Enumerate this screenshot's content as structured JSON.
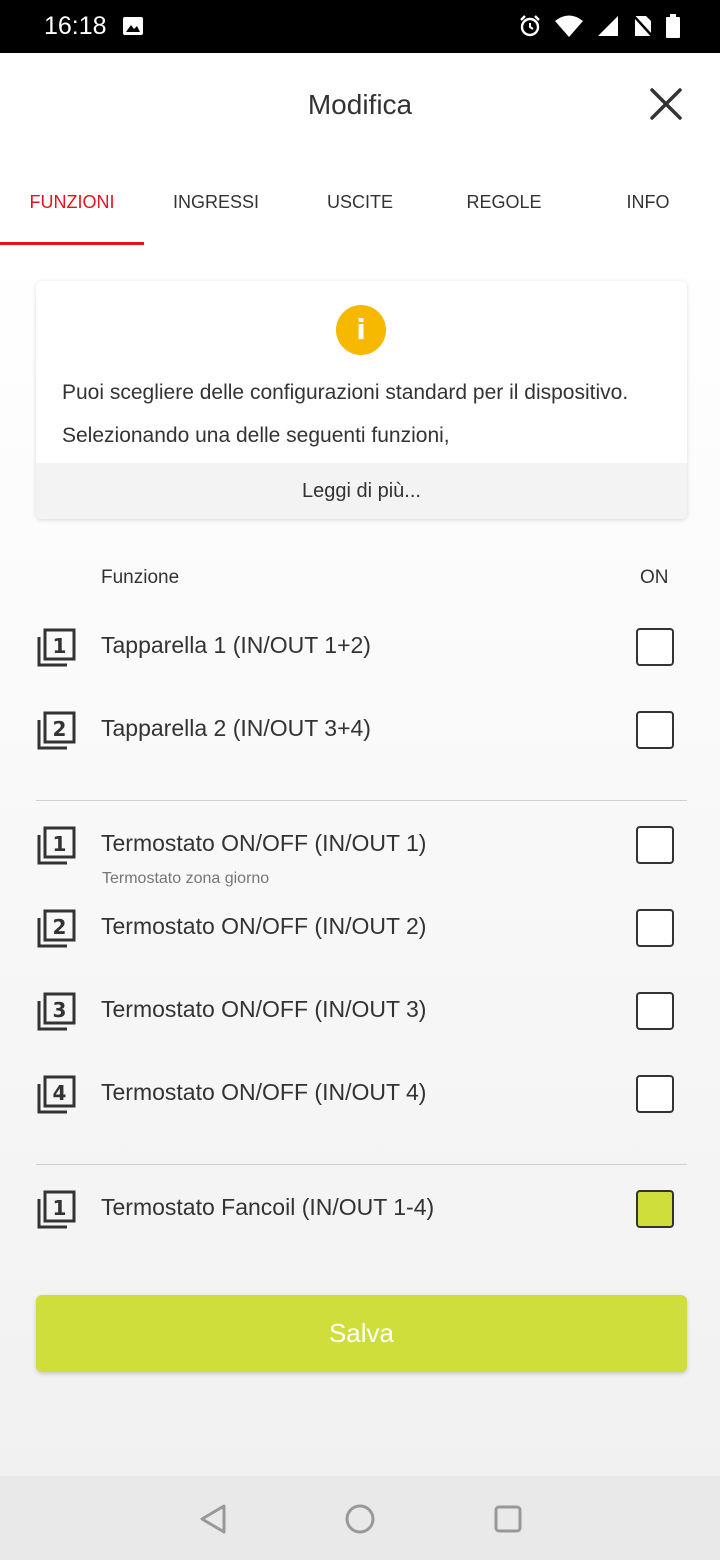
{
  "status_bar": {
    "time": "16:18"
  },
  "header": {
    "title": "Modifica"
  },
  "tabs": [
    {
      "label": "FUNZIONI"
    },
    {
      "label": "INGRESSI"
    },
    {
      "label": "USCITE"
    },
    {
      "label": "REGOLE"
    },
    {
      "label": "INFO"
    }
  ],
  "info_card": {
    "text": "Puoi scegliere delle configurazioni standard per il dispositivo. Selezionando una delle seguenti funzioni,",
    "read_more": "Leggi di più..."
  },
  "columns": {
    "function": "Funzione",
    "on": "ON"
  },
  "functions": [
    {
      "icon_number": "1",
      "label": "Tapparella 1 (IN/OUT 1+2)",
      "checked": false
    },
    {
      "icon_number": "2",
      "label": "Tapparella 2 (IN/OUT 3+4)",
      "checked": false
    },
    {
      "icon_number": "1",
      "label": "Termostato ON/OFF (IN/OUT 1)",
      "sublabel": "Termostato zona giorno",
      "checked": false
    },
    {
      "icon_number": "2",
      "label": "Termostato ON/OFF (IN/OUT 2)",
      "checked": false
    },
    {
      "icon_number": "3",
      "label": "Termostato ON/OFF (IN/OUT 3)",
      "checked": false
    },
    {
      "icon_number": "4",
      "label": "Termostato ON/OFF (IN/OUT 4)",
      "checked": false
    },
    {
      "icon_number": "1",
      "label": "Termostato Fancoil (IN/OUT 1-4)",
      "checked": true
    }
  ],
  "save_button": {
    "label": "Salva"
  },
  "colors": {
    "accent_red": "#e4141b",
    "accent_green": "#cfde3a",
    "info_yellow": "#f6b900"
  }
}
